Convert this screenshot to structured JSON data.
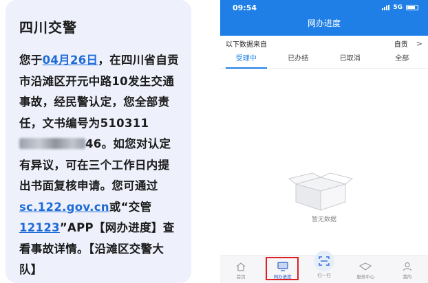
{
  "sms": {
    "sender": "四川交警",
    "body": {
      "part1": "您于",
      "date_link": "04月26日",
      "part2": "，在四川省自贡市沿滩区开元中路10发生交通事故，经民警认定，您全部责任，文书编号为",
      "doc_prefix": "510311",
      "doc_suffix": "46",
      "part3": "。如您对认定有异议，可在三个工作日内提出书面复核申请。您可通过",
      "url_link": "sc.122.gov.cn",
      "part4": "或“交管",
      "app_link": "12123",
      "part5": "”APP【网办进度】查看事故详情。【沿滩区交警大队】"
    }
  },
  "phone": {
    "status": {
      "time": "09:54",
      "network": "5G"
    },
    "nav_title": "网办进度",
    "source": {
      "label": "以下数据来自",
      "city": "自贡",
      "chevron": ">"
    },
    "tabs": [
      {
        "label": "受理中",
        "active": true
      },
      {
        "label": "已办结",
        "active": false
      },
      {
        "label": "已取消",
        "active": false
      },
      {
        "label": "全部",
        "active": false
      }
    ],
    "empty_text": "暂无数据",
    "bottom_nav": [
      {
        "label": "首页",
        "icon": "home-icon"
      },
      {
        "label": "网办进度",
        "icon": "monitor-icon",
        "active": true
      },
      {
        "label": "扫一扫",
        "icon": "scan-icon"
      },
      {
        "label": "服务中心",
        "icon": "diamond-icon"
      },
      {
        "label": "我的",
        "icon": "user-icon"
      }
    ],
    "colors": {
      "primary": "#1f7fe6",
      "highlight": "#e02020",
      "link": "#1e6bd8"
    }
  }
}
